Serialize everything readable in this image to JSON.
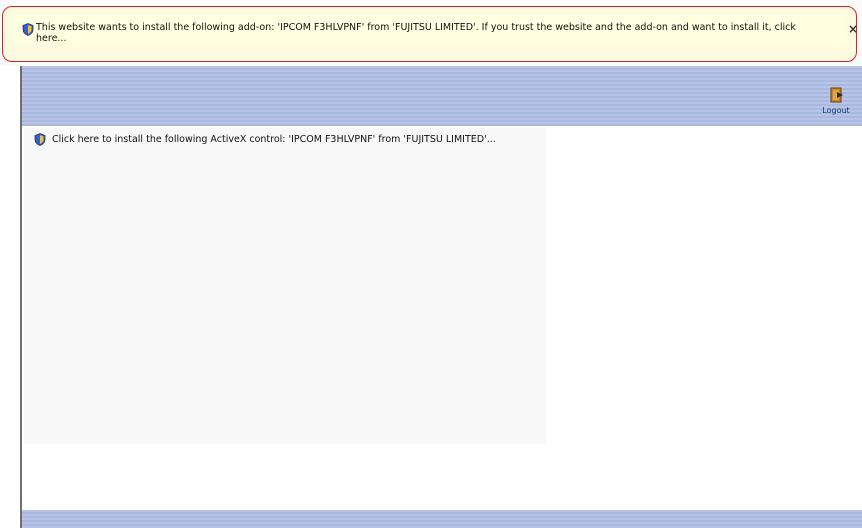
{
  "infobar": {
    "icon": "shield-icon",
    "message": "This website wants to install the following add-on: 'IPCOM F3HLVPNF' from 'FUJITSU LIMITED'. If you trust the website and the add-on and want to install it, click here...",
    "close_glyph": "×"
  },
  "header": {
    "logout_label": "Logout",
    "logout_icon": "logout-icon"
  },
  "content": {
    "activex_icon": "shield-icon",
    "activex_message": "Click here to install the following ActiveX control: 'IPCOM F3HLVPNF' from 'FUJITSU LIMITED'..."
  },
  "colors": {
    "infobar_background": "#ffffe1",
    "infobar_highlight_border": "#e02020",
    "header_band": "#b3c1e5"
  }
}
